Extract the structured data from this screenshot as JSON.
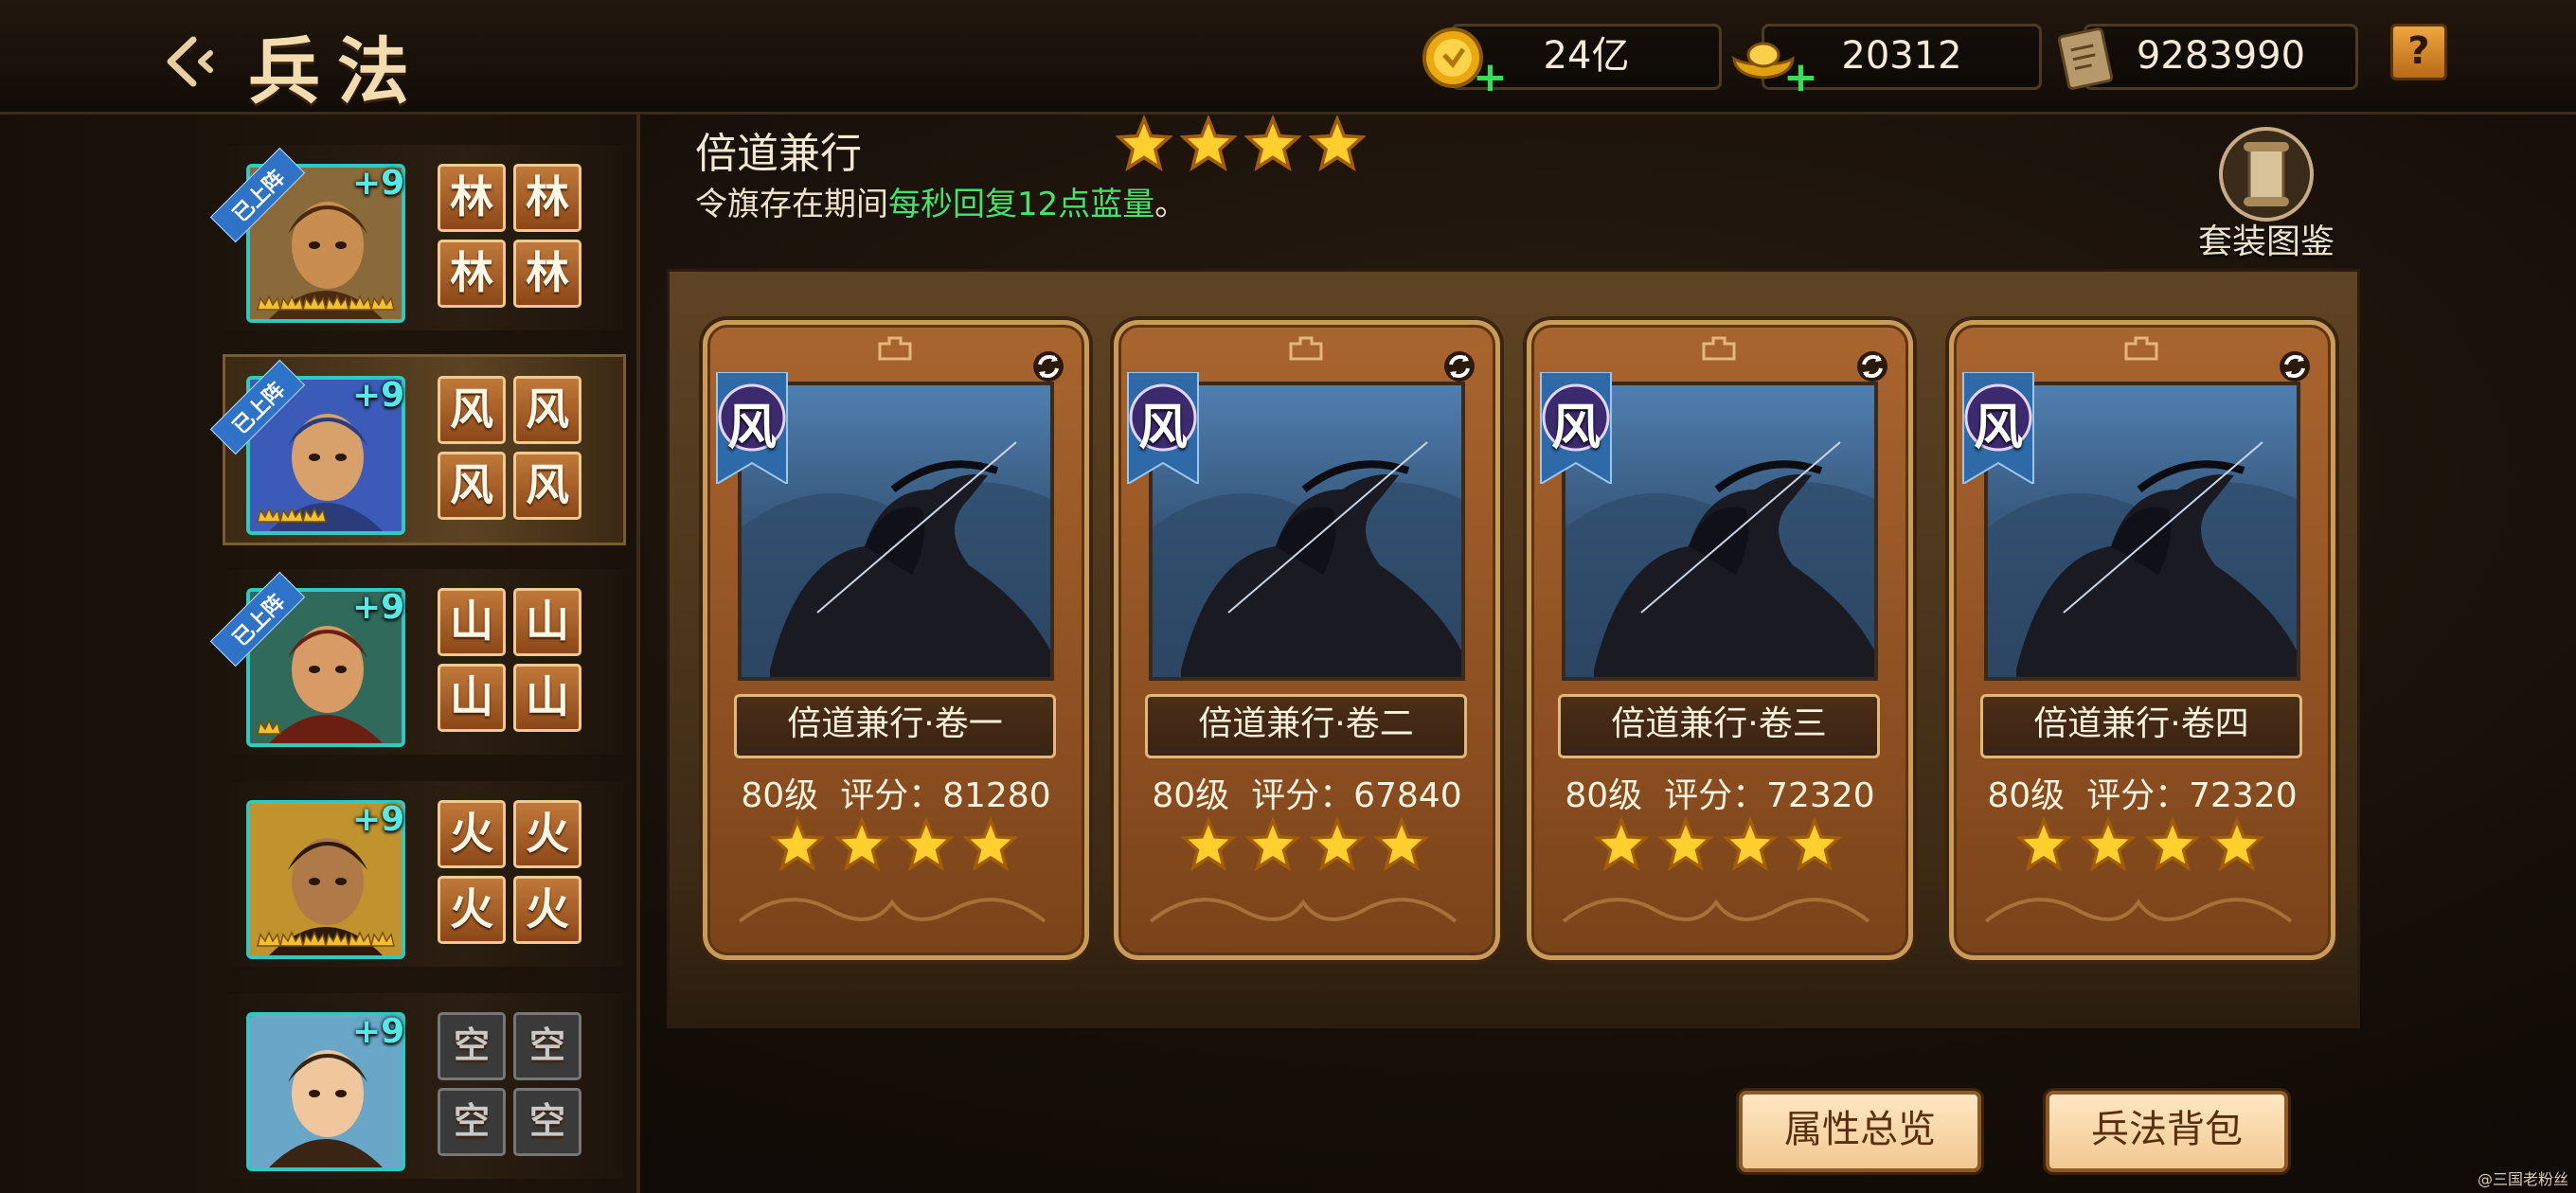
{
  "header": {
    "title": "兵法",
    "resources": [
      {
        "value": "24亿",
        "icon": "gold-coin-icon"
      },
      {
        "value": "20312",
        "icon": "gold-ingot-icon"
      },
      {
        "value": "9283990",
        "icon": "scroll-icon"
      }
    ],
    "help_label": "?"
  },
  "heroes": [
    {
      "level": "+9",
      "equipped": "已上阵",
      "slots": [
        "林",
        "林",
        "林",
        "林"
      ],
      "crowns": 6
    },
    {
      "level": "+9",
      "equipped": "已上阵",
      "slots": [
        "风",
        "风",
        "风",
        "风"
      ],
      "crowns": 3
    },
    {
      "level": "+9",
      "equipped": "已上阵",
      "slots": [
        "山",
        "山",
        "山",
        "山"
      ],
      "crowns": 1
    },
    {
      "level": "+9",
      "equipped": "",
      "slots": [
        "火",
        "火",
        "火",
        "火"
      ],
      "crowns": 6
    },
    {
      "level": "+9",
      "equipped": "",
      "slots": [
        "空",
        "空",
        "空",
        "空"
      ],
      "crowns": 0
    }
  ],
  "set": {
    "name": "倍道兼行",
    "stars": 4,
    "desc_prefix": "令旗存在期间",
    "desc_highlight": "每秒回复12点蓝量",
    "desc_suffix": "。",
    "codex_label": "套装图鉴"
  },
  "cards": [
    {
      "badge": "风",
      "name": "倍道兼行·卷一",
      "level": "80级",
      "score_label": "评分：",
      "score": "81280",
      "stars": 4
    },
    {
      "badge": "风",
      "name": "倍道兼行·卷二",
      "level": "80级",
      "score_label": "评分：",
      "score": "67840",
      "stars": 4
    },
    {
      "badge": "风",
      "name": "倍道兼行·卷三",
      "level": "80级",
      "score_label": "评分：",
      "score": "72320",
      "stars": 4
    },
    {
      "badge": "风",
      "name": "倍道兼行·卷四",
      "level": "80级",
      "score_label": "评分：",
      "score": "72320",
      "stars": 4
    }
  ],
  "buttons": {
    "overview": "属性总览",
    "bag": "兵法背包"
  },
  "watermark": "@三国老粉丝",
  "colors": {
    "accent_green": "#46e36a",
    "frame_teal": "#36c6c0",
    "card_brown": "#8e5022"
  }
}
